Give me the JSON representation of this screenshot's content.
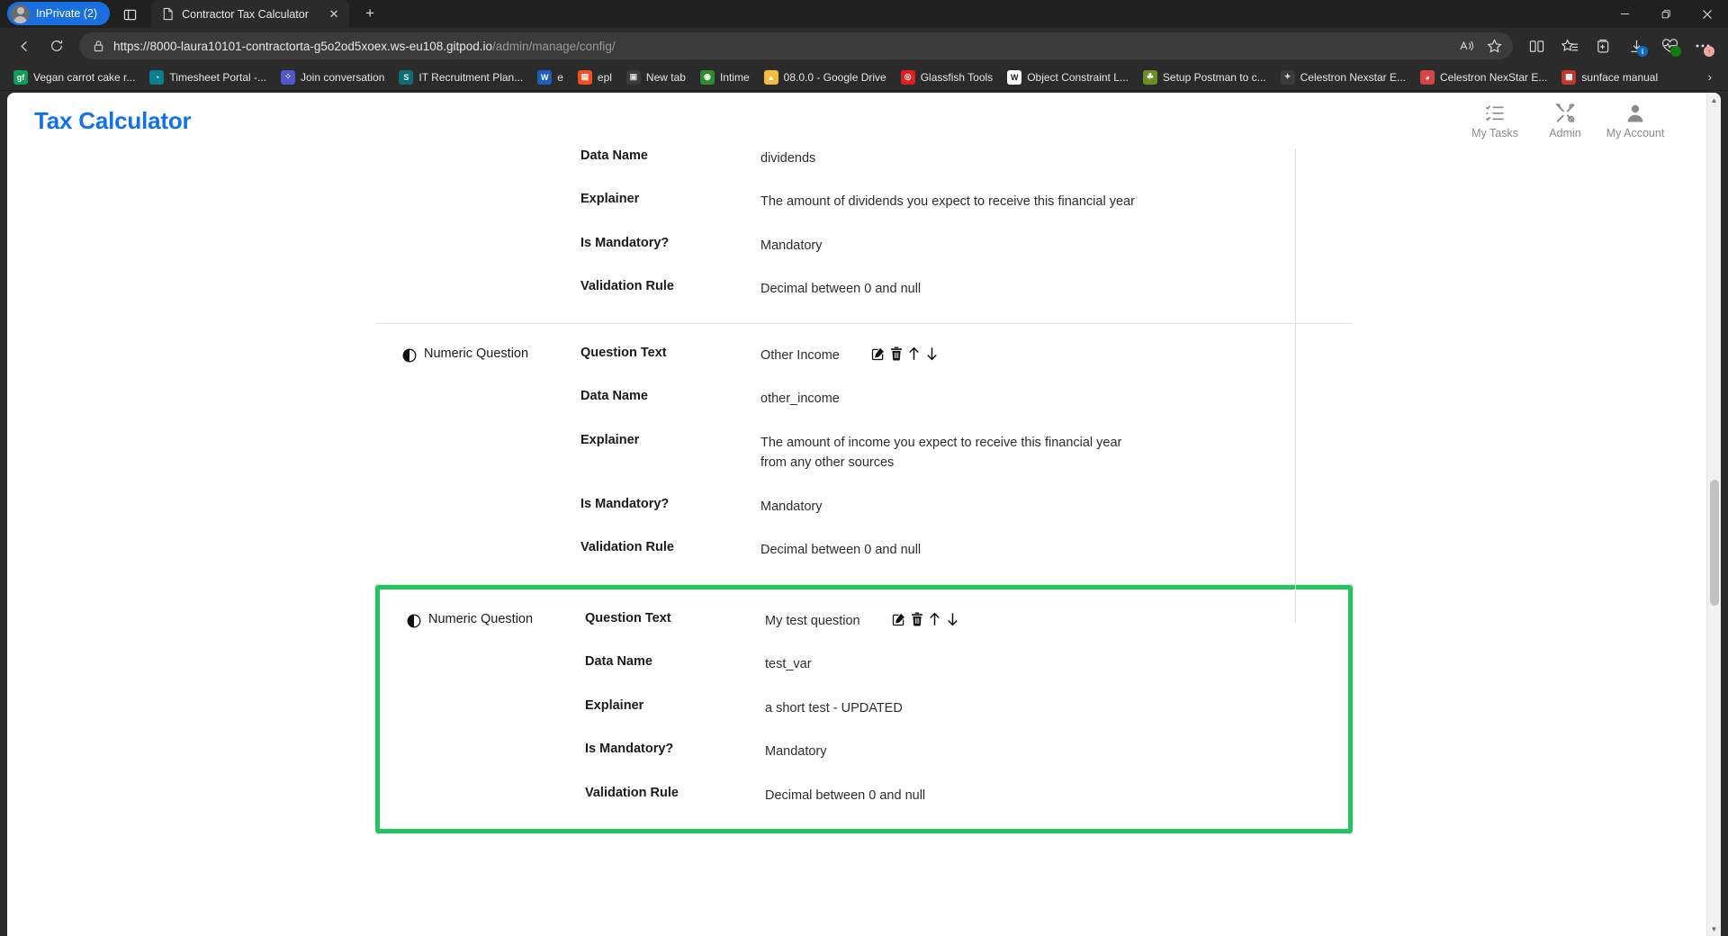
{
  "browser": {
    "profile_pill": "InPrivate (2)",
    "tab": {
      "title": "Contractor Tax Calculator",
      "close_glyph": "✕"
    },
    "new_tab_glyph": "+",
    "window_controls": {
      "minimize": "—",
      "maximize": "❐",
      "close": "✕"
    },
    "nav": {
      "back": "←",
      "forward": "→",
      "refresh": "⟳"
    },
    "url": {
      "scheme_host": "https://8000-laura10101-contractorta-g5o2od5xoex.ws-eu108.gitpod.io",
      "path": "/admin/manage/config/"
    },
    "toolbar_icons": [
      {
        "name": "read-aloud-icon",
        "glyph": "A"
      },
      {
        "name": "favorite-star-icon",
        "glyph": "☆"
      },
      {
        "name": "split-screen-icon",
        "glyph": "◫"
      },
      {
        "name": "favorites-list-icon",
        "glyph": "☆"
      },
      {
        "name": "collections-icon",
        "glyph": "⊞"
      },
      {
        "name": "downloads-icon",
        "glyph": "↓",
        "badge": "i",
        "badge_color": "blue"
      },
      {
        "name": "browser-essentials-icon",
        "glyph": "♡",
        "badge": "",
        "badge_color": "green"
      },
      {
        "name": "settings-more-icon",
        "glyph": "⋯",
        "badge": "↑",
        "badge_color": "orange"
      }
    ],
    "bookmarks": [
      {
        "label": "Vegan carrot cake r...",
        "icon": "gf",
        "bg": "#0f9d58",
        "fg": "#ffffff"
      },
      {
        "label": "Timesheet Portal -...",
        "icon": "◔",
        "bg": "#0b7d8c",
        "fg": "#ffffff"
      },
      {
        "label": "Join conversation",
        "icon": "⁘",
        "bg": "#5059c9",
        "fg": "#ffffff"
      },
      {
        "label": "IT Recruitment Plan...",
        "icon": "S",
        "bg": "#0a6e74",
        "fg": "#ffffff"
      },
      {
        "label": "e",
        "icon": "W",
        "bg": "#1b5ebe",
        "fg": "#ffffff"
      },
      {
        "label": "epl",
        "icon": "▤",
        "bg": "#f25022",
        "fg": "#ffffff"
      },
      {
        "label": "New tab",
        "icon": "▣",
        "bg": "#3b3b3b",
        "fg": "#d8d8d8"
      },
      {
        "label": "Intime",
        "icon": "◉",
        "bg": "#2e8b30",
        "fg": "#ffffff"
      },
      {
        "label": "08.0.0 - Google Drive",
        "icon": "▲",
        "bg": "#f5bb41",
        "fg": "#ffffff"
      },
      {
        "label": "Glassfish Tools",
        "icon": "◎",
        "bg": "#e02020",
        "fg": "#ffffff"
      },
      {
        "label": "Object Constraint L...",
        "icon": "W",
        "bg": "#ffffff",
        "fg": "#1b1b1b"
      },
      {
        "label": "Setup Postman to c...",
        "icon": "☘",
        "bg": "#6b8e23",
        "fg": "#ffffff"
      },
      {
        "label": "Celestron Nexstar E...",
        "icon": "✦",
        "bg": "#3b3b3b",
        "fg": "#dcdcdc"
      },
      {
        "label": "Celestron NexStar E...",
        "icon": "◕",
        "bg": "#d64545",
        "fg": "#ffffff"
      },
      {
        "label": "sunface manual",
        "icon": "▦",
        "bg": "#c0392b",
        "fg": "#ffffff"
      }
    ],
    "bookmarks_overflow_glyph": "›"
  },
  "app": {
    "brand": "Tax Calculator",
    "nav": [
      {
        "name": "my-tasks",
        "label": "My Tasks",
        "icon": "task-list-icon"
      },
      {
        "name": "admin",
        "label": "Admin",
        "icon": "tools-icon"
      },
      {
        "name": "my-account",
        "label": "My Account",
        "icon": "person-icon"
      }
    ],
    "field_labels": {
      "question_text": "Question Text",
      "data_name": "Data Name",
      "explainer": "Explainer",
      "is_mandatory": "Is Mandatory?",
      "validation_rule": "Validation Rule"
    },
    "actions": {
      "edit": "edit-icon",
      "delete": "trash-icon",
      "move_up": "arrow-up-icon",
      "move_down": "arrow-down-icon"
    },
    "questions": [
      {
        "type": "Numeric Question",
        "question_text": "",
        "data_name": "dividends",
        "explainer": "The amount of dividends you expect to receive this financial year",
        "is_mandatory": "Mandatory",
        "validation_rule": "Decimal between 0 and null",
        "partial": true,
        "highlighted": false
      },
      {
        "type": "Numeric Question",
        "question_text": "Other Income",
        "data_name": "other_income",
        "explainer": "The amount of income you expect to receive this financial year from any other sources",
        "is_mandatory": "Mandatory",
        "validation_rule": "Decimal between 0 and null",
        "partial": false,
        "highlighted": false
      },
      {
        "type": "Numeric Question",
        "question_text": "My test question",
        "data_name": "test_var",
        "explainer": "a short test - UPDATED",
        "is_mandatory": "Mandatory",
        "validation_rule": "Decimal between 0 and null",
        "partial": false,
        "highlighted": true
      }
    ],
    "highlight_color": "#22c55e",
    "brand_color": "#1373e6"
  }
}
